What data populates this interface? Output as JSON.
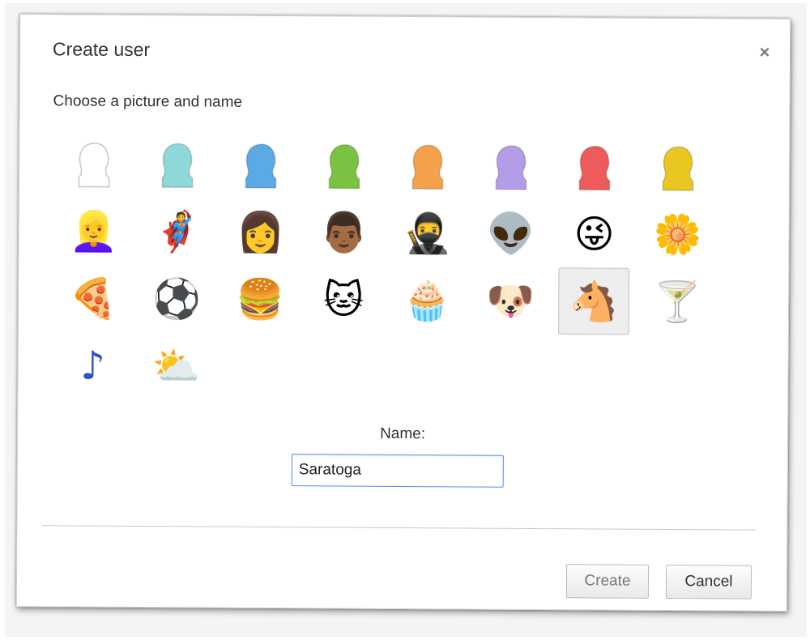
{
  "dialog": {
    "title": "Create user",
    "close_label": "×",
    "subtitle": "Choose a picture and name",
    "name_label": "Name:",
    "name_value": "Saratoga",
    "create_label": "Create",
    "cancel_label": "Cancel"
  },
  "avatars": [
    {
      "name": "avatar-generic-white",
      "color": "#ffffff"
    },
    {
      "name": "avatar-generic-cyan",
      "color": "#8fd8d8"
    },
    {
      "name": "avatar-generic-blue",
      "color": "#5aaae6"
    },
    {
      "name": "avatar-generic-green",
      "color": "#7cc242"
    },
    {
      "name": "avatar-generic-orange",
      "color": "#f5a04a"
    },
    {
      "name": "avatar-generic-purple",
      "color": "#b39ce8"
    },
    {
      "name": "avatar-generic-red",
      "color": "#ee5b5b"
    },
    {
      "name": "avatar-generic-yellow",
      "color": "#e8c820"
    },
    {
      "name": "avatar-blonde-woman",
      "glyph": "👱‍♀️"
    },
    {
      "name": "avatar-superhero",
      "glyph": "🦸"
    },
    {
      "name": "avatar-woman-sunglasses",
      "glyph": "👩"
    },
    {
      "name": "avatar-businessman",
      "glyph": "👨🏾"
    },
    {
      "name": "avatar-ninja",
      "glyph": "🥷"
    },
    {
      "name": "avatar-alien",
      "glyph": "👽"
    },
    {
      "name": "avatar-smiley",
      "glyph": "😜"
    },
    {
      "name": "avatar-flower",
      "glyph": "🌼"
    },
    {
      "name": "avatar-pizza",
      "glyph": "🍕"
    },
    {
      "name": "avatar-soccer-ball",
      "glyph": "⚽"
    },
    {
      "name": "avatar-burger",
      "glyph": "🍔"
    },
    {
      "name": "avatar-cat",
      "glyph": "🐱"
    },
    {
      "name": "avatar-cupcake",
      "glyph": "🧁"
    },
    {
      "name": "avatar-dog",
      "glyph": "🐶"
    },
    {
      "name": "avatar-horse",
      "glyph": "🐴",
      "selected": true
    },
    {
      "name": "avatar-cocktail",
      "glyph": "🍸"
    },
    {
      "name": "avatar-music-note",
      "glyph": "♪",
      "color": "#2f4fd0"
    },
    {
      "name": "avatar-weather",
      "glyph": "⛅"
    }
  ]
}
